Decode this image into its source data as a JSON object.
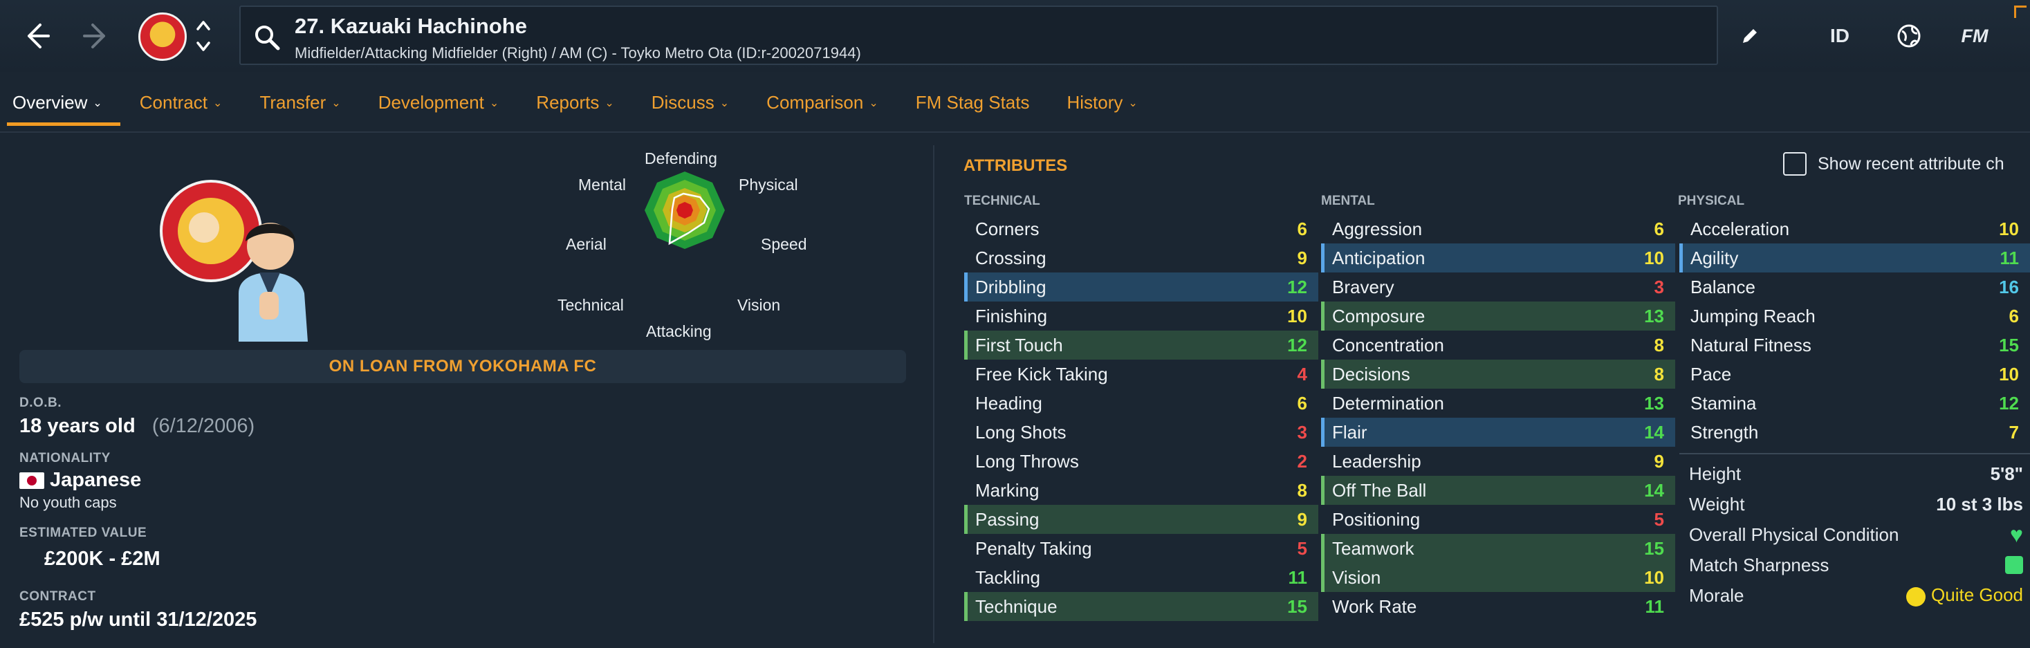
{
  "header": {
    "player_title": "27. Kazuaki Hachinohe",
    "player_subtitle": "Midfielder/Attacking Midfielder (Right) / AM (C) - Toyko Metro Ota (ID:r-2002071944)",
    "id_label": "ID",
    "fm_label": "FM"
  },
  "tabs": [
    {
      "label": "Overview",
      "active": true
    },
    {
      "label": "Contract"
    },
    {
      "label": "Transfer"
    },
    {
      "label": "Development"
    },
    {
      "label": "Reports"
    },
    {
      "label": "Discuss"
    },
    {
      "label": "Comparison"
    },
    {
      "label": "FM Stag Stats"
    },
    {
      "label": "History"
    }
  ],
  "profile": {
    "loan_text": "ON LOAN FROM YOKOHAMA FC",
    "dob_label": "D.O.B.",
    "age": "18 years old",
    "dob": "(6/12/2006)",
    "nationality_label": "NATIONALITY",
    "nationality": "Japanese",
    "youth_caps": "No youth caps",
    "value_label": "ESTIMATED VALUE",
    "value": "£200K - £2M",
    "contract_label": "CONTRACT",
    "contract": "£525 p/w until 31/12/2025"
  },
  "radar": {
    "labels": [
      "Defending",
      "Physical",
      "Speed",
      "Vision",
      "Attacking",
      "Technical",
      "Aerial",
      "Mental"
    ]
  },
  "attributes": {
    "title": "ATTRIBUTES",
    "recent_toggle": "Show recent attribute ch",
    "technical": {
      "header": "TECHNICAL",
      "rows": [
        {
          "name": "Corners",
          "value": "6",
          "color": "yellow"
        },
        {
          "name": "Crossing",
          "value": "9",
          "color": "yellow"
        },
        {
          "name": "Dribbling",
          "value": "12",
          "color": "green",
          "hl": "blue"
        },
        {
          "name": "Finishing",
          "value": "10",
          "color": "yellow"
        },
        {
          "name": "First Touch",
          "value": "12",
          "color": "green",
          "hl": "green"
        },
        {
          "name": "Free Kick Taking",
          "value": "4",
          "color": "red"
        },
        {
          "name": "Heading",
          "value": "6",
          "color": "yellow"
        },
        {
          "name": "Long Shots",
          "value": "3",
          "color": "red"
        },
        {
          "name": "Long Throws",
          "value": "2",
          "color": "red"
        },
        {
          "name": "Marking",
          "value": "8",
          "color": "yellow"
        },
        {
          "name": "Passing",
          "value": "9",
          "color": "yellow",
          "hl": "green"
        },
        {
          "name": "Penalty Taking",
          "value": "5",
          "color": "red"
        },
        {
          "name": "Tackling",
          "value": "11",
          "color": "green"
        },
        {
          "name": "Technique",
          "value": "15",
          "color": "green",
          "hl": "green"
        }
      ]
    },
    "mental": {
      "header": "MENTAL",
      "rows": [
        {
          "name": "Aggression",
          "value": "6",
          "color": "yellow"
        },
        {
          "name": "Anticipation",
          "value": "10",
          "color": "yellow",
          "hl": "blue"
        },
        {
          "name": "Bravery",
          "value": "3",
          "color": "red"
        },
        {
          "name": "Composure",
          "value": "13",
          "color": "green",
          "hl": "green"
        },
        {
          "name": "Concentration",
          "value": "8",
          "color": "yellow"
        },
        {
          "name": "Decisions",
          "value": "8",
          "color": "yellow",
          "hl": "green"
        },
        {
          "name": "Determination",
          "value": "13",
          "color": "green"
        },
        {
          "name": "Flair",
          "value": "14",
          "color": "green",
          "hl": "blue"
        },
        {
          "name": "Leadership",
          "value": "9",
          "color": "yellow"
        },
        {
          "name": "Off The Ball",
          "value": "14",
          "color": "green",
          "hl": "green"
        },
        {
          "name": "Positioning",
          "value": "5",
          "color": "red"
        },
        {
          "name": "Teamwork",
          "value": "15",
          "color": "green",
          "hl": "green"
        },
        {
          "name": "Vision",
          "value": "10",
          "color": "yellow",
          "hl": "green"
        },
        {
          "name": "Work Rate",
          "value": "11",
          "color": "green"
        }
      ]
    },
    "physical": {
      "header": "PHYSICAL",
      "rows": [
        {
          "name": "Acceleration",
          "value": "10",
          "color": "yellow"
        },
        {
          "name": "Agility",
          "value": "11",
          "color": "green",
          "hl": "blue"
        },
        {
          "name": "Balance",
          "value": "16",
          "color": "cyan"
        },
        {
          "name": "Jumping Reach",
          "value": "6",
          "color": "yellow"
        },
        {
          "name": "Natural Fitness",
          "value": "15",
          "color": "green"
        },
        {
          "name": "Pace",
          "value": "10",
          "color": "yellow"
        },
        {
          "name": "Stamina",
          "value": "12",
          "color": "green"
        },
        {
          "name": "Strength",
          "value": "7",
          "color": "yellow"
        }
      ]
    },
    "physical_info": {
      "height_label": "Height",
      "height": "5'8\"",
      "weight_label": "Weight",
      "weight": "10 st 3 lbs",
      "condition_label": "Overall Physical Condition",
      "sharpness_label": "Match Sharpness",
      "morale_label": "Morale",
      "morale": "Quite Good"
    }
  }
}
